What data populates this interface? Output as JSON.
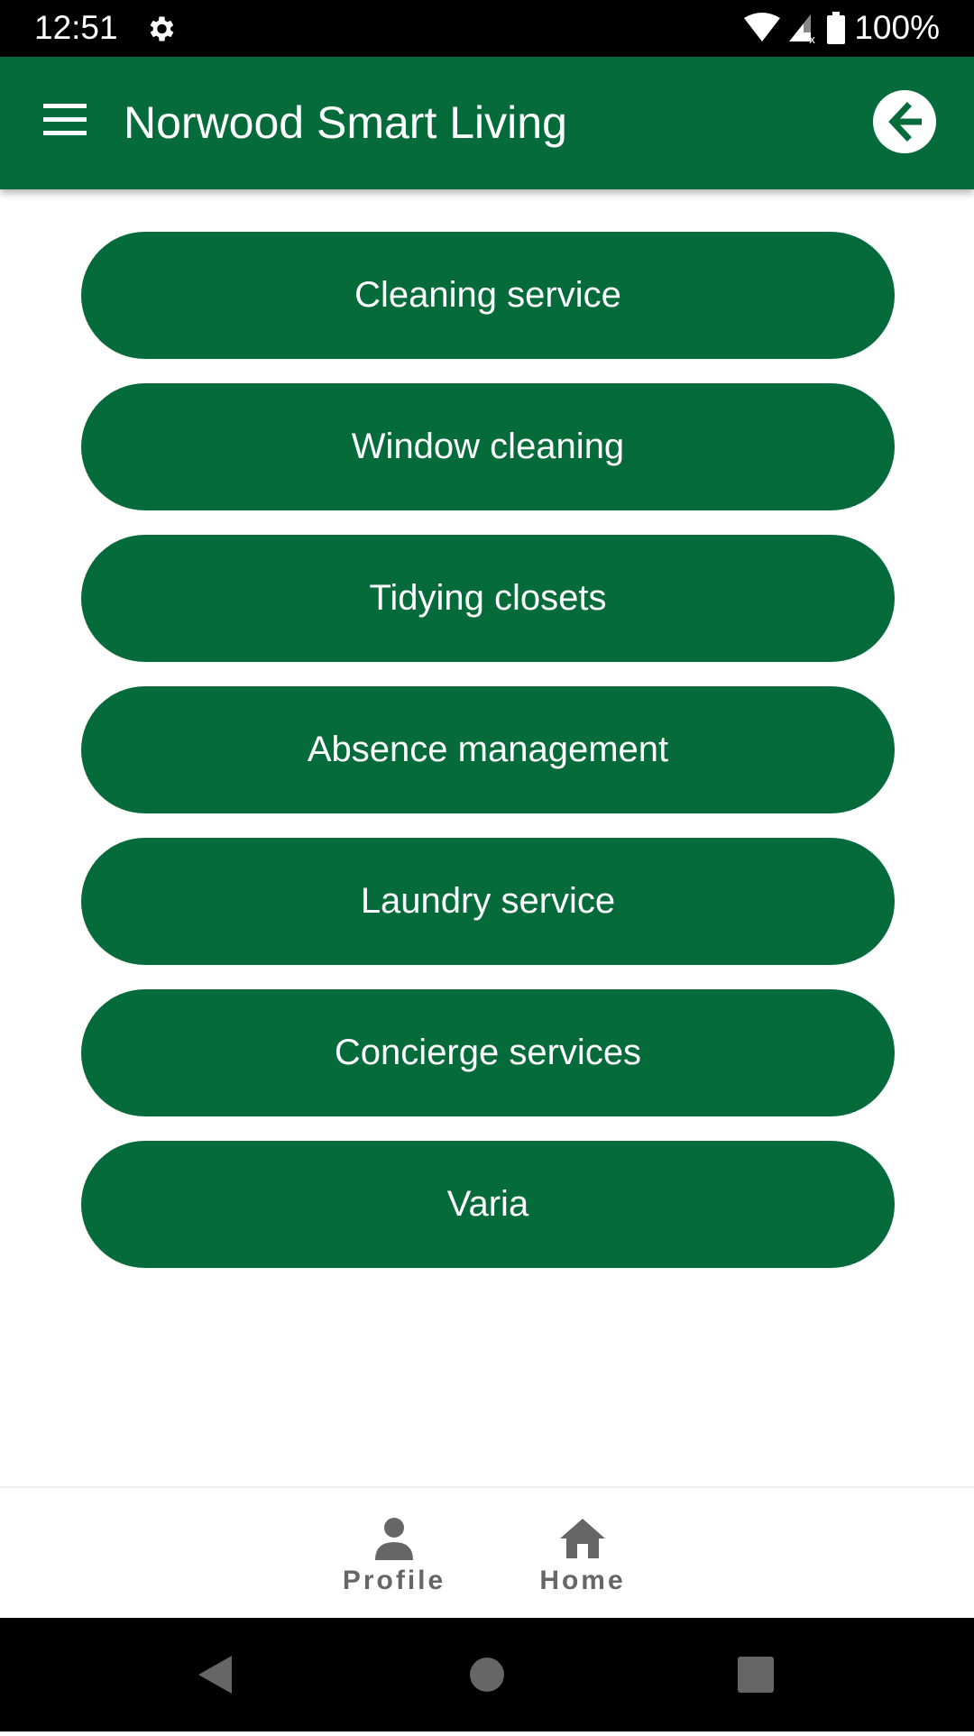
{
  "status_bar": {
    "time": "12:51",
    "battery": "100%",
    "icons": [
      "settings-icon",
      "wifi-icon",
      "signal-icon",
      "battery-icon"
    ]
  },
  "app_bar": {
    "title": "Norwood Smart Living",
    "menu_icon": "menu-icon",
    "back_icon": "arrow-left-icon"
  },
  "services": [
    {
      "label": "Cleaning service"
    },
    {
      "label": "Window cleaning"
    },
    {
      "label": "Tidying closets"
    },
    {
      "label": "Absence management"
    },
    {
      "label": "Laundry service"
    },
    {
      "label": "Concierge services"
    },
    {
      "label": "Varia"
    }
  ],
  "bottom_nav": {
    "items": [
      {
        "label": "Profile",
        "icon": "person-icon"
      },
      {
        "label": "Home",
        "icon": "home-icon"
      }
    ]
  },
  "system_nav": {
    "buttons": [
      "back",
      "home",
      "recents"
    ]
  },
  "colors": {
    "primary": "#066b3a",
    "nav_icon": "#666666"
  }
}
